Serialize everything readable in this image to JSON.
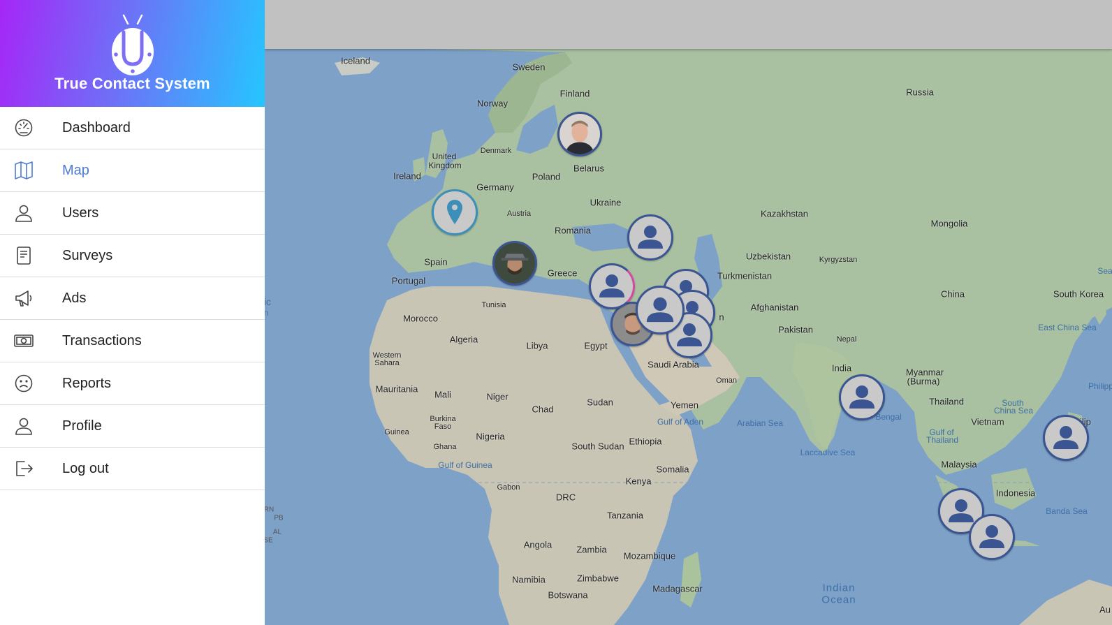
{
  "app": {
    "title": "True Contact System"
  },
  "menu": [
    {
      "label": "Dashboard",
      "icon": "speedometer-icon",
      "active": false
    },
    {
      "label": "Map",
      "icon": "map-icon",
      "active": true
    },
    {
      "label": "Users",
      "icon": "user-icon",
      "active": false
    },
    {
      "label": "Surveys",
      "icon": "document-icon",
      "active": false
    },
    {
      "label": "Ads",
      "icon": "megaphone-icon",
      "active": false
    },
    {
      "label": "Transactions",
      "icon": "banknote-icon",
      "active": false
    },
    {
      "label": "Reports",
      "icon": "sad-face-icon",
      "active": false
    },
    {
      "label": "Profile",
      "icon": "user-icon",
      "active": false
    },
    {
      "label": "Log out",
      "icon": "logout-icon",
      "active": false
    }
  ],
  "colors": {
    "accent": "#4e7bd1",
    "marker_border": "#3a5591",
    "pin": "#3c8fb8"
  },
  "map": {
    "countries": {
      "iceland": "Iceland",
      "sweden": "Sweden",
      "finland": "Finland",
      "norway": "Norway",
      "russia": "Russia",
      "uk1": "United",
      "uk2": "Kingdom",
      "denmark": "Denmark",
      "ireland": "Ireland",
      "belarus": "Belarus",
      "poland": "Poland",
      "germany": "Germany",
      "ukraine": "Ukraine",
      "austria": "Austria",
      "kazakhstan": "Kazakhstan",
      "romania": "Romania",
      "mongolia": "Mongolia",
      "spain": "Spain",
      "uzbekistan": "Uzbekistan",
      "kyrgyzstan": "Kyrgyzstan",
      "portugal": "Portugal",
      "greece": "Greece",
      "turkmenistan": "Turkmenistan",
      "china": "China",
      "south_korea": "South Korea",
      "tunisia": "Tunisia",
      "afghanistan": "Afghanistan",
      "morocco": "Morocco",
      "pakistan": "Pakistan",
      "algeria": "Algeria",
      "libya": "Libya",
      "egypt": "Egypt",
      "nepal": "Nepal",
      "western1": "Western",
      "western2": "Sahara",
      "saudi": "Saudi Arabia",
      "india": "India",
      "myanmar1": "Myanmar",
      "myanmar2": "(Burma)",
      "oman": "Oman",
      "mauritania": "Mauritania",
      "mali": "Mali",
      "niger": "Niger",
      "sudan": "Sudan",
      "yemen": "Yemen",
      "thailand": "Thailand",
      "chad": "Chad",
      "vietnam": "Vietnam",
      "burkina1": "Burkina",
      "burkina2": "Faso",
      "guinea": "Guinea",
      "nigeria": "Nigeria",
      "ghana": "Ghana",
      "south_sudan": "South Sudan",
      "ethiopia": "Ethiopia",
      "malaysia": "Malaysia",
      "somalia": "Somalia",
      "gabon": "Gabon",
      "kenya": "Kenya",
      "indonesia": "Indonesia",
      "drc": "DRC",
      "tanzania": "Tanzania",
      "angola": "Angola",
      "zambia": "Zambia",
      "mozambique": "Mozambique",
      "namibia": "Namibia",
      "zimbabwe": "Zimbabwe",
      "madagascar": "Madagascar",
      "botswana": "Botswana",
      "philip": "Philip",
      "au": "Au",
      "n_fragment": "n"
    },
    "waters": {
      "east_china_sea": "East China Sea",
      "south_china_sea1": "South",
      "south_china_sea2": "China Sea",
      "arabian_sea": "Arabian Sea",
      "gulf_aden": "Gulf of Aden",
      "bengal": "Bengal",
      "gulf_thailand1": "Gulf of",
      "gulf_thailand2": "Thailand",
      "laccadive": "Laccadive Sea",
      "banda": "Banda Sea",
      "gulf_guinea": "Gulf of Guinea",
      "indian1": "Indian",
      "indian2": "Ocean",
      "sea_frag": "Sea",
      "philipp_frag": "Philipp",
      "atl1": "ic",
      "atl2": "n",
      "rn": "RN",
      "pb": "PB",
      "al": "AL",
      "se": "SE"
    }
  }
}
